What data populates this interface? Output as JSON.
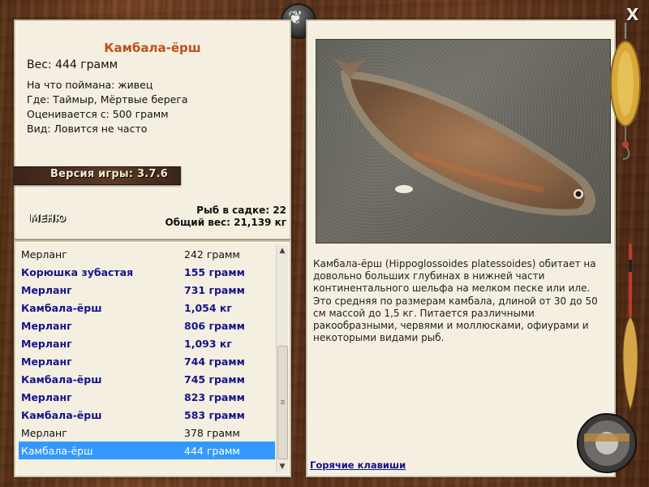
{
  "info": {
    "title": "Камбала-ёрш",
    "weight": "Вес: 444 грамм",
    "caught_with": "На что поймана: живец",
    "where": "Где: Таймыр, Мёртвые берега",
    "valued_from": "Оценивается с: 500 грамм",
    "kind": "Вид: Ловится не часто",
    "fish_in_keepnet": "Рыб в садке: 22",
    "total_weight": "Общий вес: 21,139 кг"
  },
  "version": "Версия игры: 3.7.6",
  "menu_label": "МЕНЮ",
  "catch_list": [
    {
      "name": "Мерланг",
      "weight": "242 грамм",
      "style": "plain"
    },
    {
      "name": "Корюшка зубастая",
      "weight": "155 грамм",
      "style": "bold"
    },
    {
      "name": "Мерланг",
      "weight": "731 грамм",
      "style": "bold"
    },
    {
      "name": "Камбала-ёрш",
      "weight": "1,054 кг",
      "style": "bold"
    },
    {
      "name": "Мерланг",
      "weight": "806 грамм",
      "style": "bold"
    },
    {
      "name": "Мерланг",
      "weight": "1,093 кг",
      "style": "bold"
    },
    {
      "name": "Мерланг",
      "weight": "744 грамм",
      "style": "bold"
    },
    {
      "name": "Камбала-ёрш",
      "weight": "745 грамм",
      "style": "bold"
    },
    {
      "name": "Мерланг",
      "weight": "823 грамм",
      "style": "bold"
    },
    {
      "name": "Камбала-ёрш",
      "weight": "583 грамм",
      "style": "bold"
    },
    {
      "name": "Мерланг",
      "weight": "378 грамм",
      "style": "plain"
    },
    {
      "name": "Камбала-ёрш",
      "weight": "444 грамм",
      "style": "selected"
    }
  ],
  "description": "Камбала-ёрш (Hippoglossoides platessoides) обитает на довольно больших глубинах в нижней части континентального шельфа на мелком песке или иле. Это средняя по размерам камбала, длиной от 30 до 50 см массой до 1,5 кг. Питается различными ракообразными, червями и моллюсками, офиурами и некоторыми видами рыб.",
  "hotkeys_label": "Горячие клавиши",
  "close_glyph": "X",
  "colors": {
    "title": "#c0501c",
    "list_bold": "#14148c",
    "selection": "#3399ff",
    "panel": "#f4efe0"
  }
}
